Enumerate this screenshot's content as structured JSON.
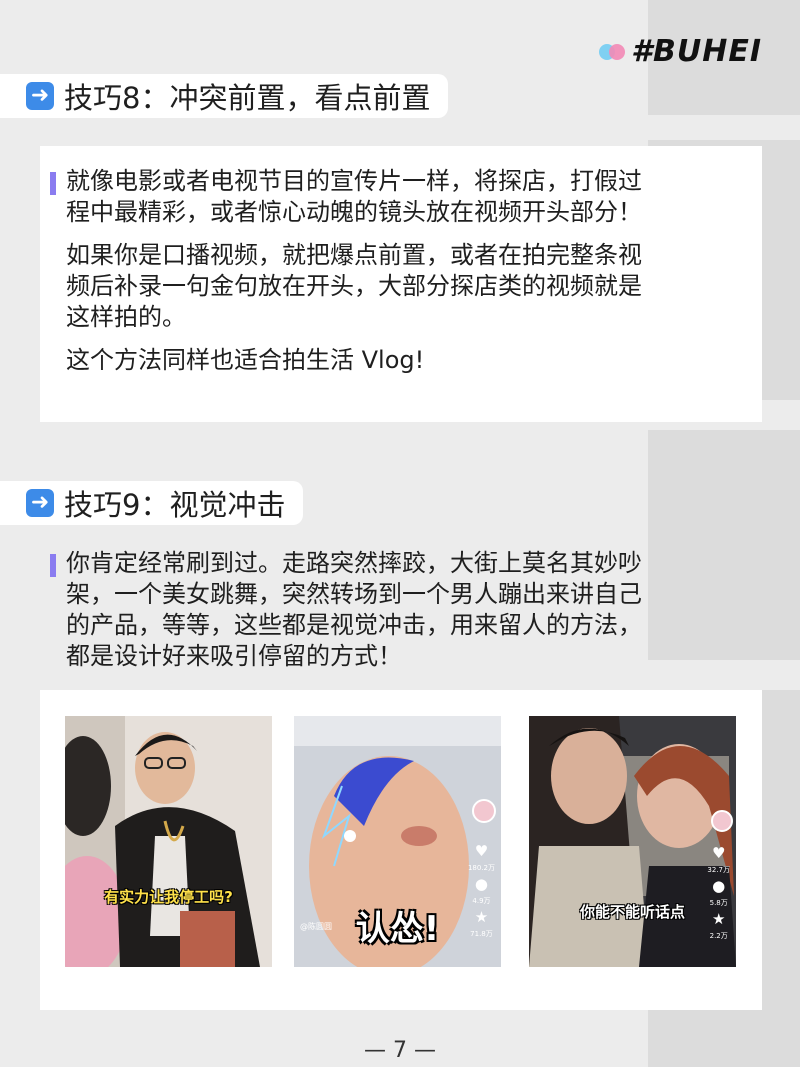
{
  "brand": {
    "logo_text": "#BUHEI"
  },
  "tip8": {
    "heading": "技巧8：冲突前置，看点前置",
    "paragraphs": [
      [
        "就像电影或者电视节目的宣传片一样，将探店，打假过",
        "程中最精彩，或者惊心动魄的镜头放在视频开头部分！"
      ],
      [
        "如果你是口播视频，就把爆点前置，或者在拍完整条视",
        "频后补录一句金句放在开头，大部分探店类的视频就是",
        "这样拍的。"
      ],
      [
        "这个方法同样也适合拍生活 Vlog!"
      ]
    ]
  },
  "tip9": {
    "heading": "技巧9：视觉冲击",
    "paragraph": [
      "你肯定经常刷到过。走路突然摔跤，大街上莫名其妙吵",
      "架，一个美女跳舞，突然转场到一个男人蹦出来讲自己",
      "的产品，等等，这些都是视觉冲击，用来留人的方法，",
      "都是设计好来吸引停留的方式！"
    ]
  },
  "photos": [
    {
      "caption": "有实力让我停工吗?"
    },
    {
      "caption": "认怂!",
      "likes": "180.2万",
      "comments": "4.9万",
      "stars": "71.8万",
      "handle": "@陈圆圆"
    },
    {
      "caption": "你能不能听话点",
      "likes": "32.7万",
      "comments": "5.8万",
      "stars": "2.2万"
    }
  ],
  "page": {
    "number": "— 7 —"
  }
}
